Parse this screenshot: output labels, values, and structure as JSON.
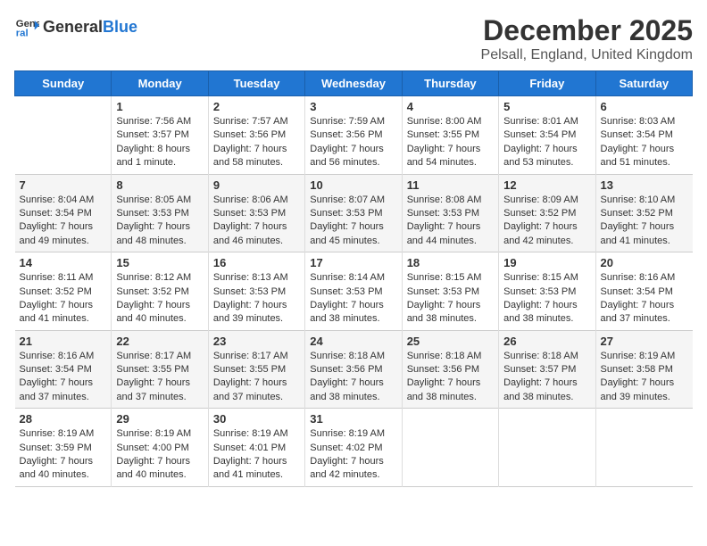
{
  "header": {
    "logo_general": "General",
    "logo_blue": "Blue",
    "title": "December 2025",
    "subtitle": "Pelsall, England, United Kingdom"
  },
  "calendar": {
    "days_of_week": [
      "Sunday",
      "Monday",
      "Tuesday",
      "Wednesday",
      "Thursday",
      "Friday",
      "Saturday"
    ],
    "weeks": [
      {
        "row_class": "white-row",
        "days": [
          {
            "num": "",
            "content": ""
          },
          {
            "num": "1",
            "content": "Sunrise: 7:56 AM\nSunset: 3:57 PM\nDaylight: 8 hours\nand 1 minute."
          },
          {
            "num": "2",
            "content": "Sunrise: 7:57 AM\nSunset: 3:56 PM\nDaylight: 7 hours\nand 58 minutes."
          },
          {
            "num": "3",
            "content": "Sunrise: 7:59 AM\nSunset: 3:56 PM\nDaylight: 7 hours\nand 56 minutes."
          },
          {
            "num": "4",
            "content": "Sunrise: 8:00 AM\nSunset: 3:55 PM\nDaylight: 7 hours\nand 54 minutes."
          },
          {
            "num": "5",
            "content": "Sunrise: 8:01 AM\nSunset: 3:54 PM\nDaylight: 7 hours\nand 53 minutes."
          },
          {
            "num": "6",
            "content": "Sunrise: 8:03 AM\nSunset: 3:54 PM\nDaylight: 7 hours\nand 51 minutes."
          }
        ]
      },
      {
        "row_class": "stripe-row",
        "days": [
          {
            "num": "7",
            "content": "Sunrise: 8:04 AM\nSunset: 3:54 PM\nDaylight: 7 hours\nand 49 minutes."
          },
          {
            "num": "8",
            "content": "Sunrise: 8:05 AM\nSunset: 3:53 PM\nDaylight: 7 hours\nand 48 minutes."
          },
          {
            "num": "9",
            "content": "Sunrise: 8:06 AM\nSunset: 3:53 PM\nDaylight: 7 hours\nand 46 minutes."
          },
          {
            "num": "10",
            "content": "Sunrise: 8:07 AM\nSunset: 3:53 PM\nDaylight: 7 hours\nand 45 minutes."
          },
          {
            "num": "11",
            "content": "Sunrise: 8:08 AM\nSunset: 3:53 PM\nDaylight: 7 hours\nand 44 minutes."
          },
          {
            "num": "12",
            "content": "Sunrise: 8:09 AM\nSunset: 3:52 PM\nDaylight: 7 hours\nand 42 minutes."
          },
          {
            "num": "13",
            "content": "Sunrise: 8:10 AM\nSunset: 3:52 PM\nDaylight: 7 hours\nand 41 minutes."
          }
        ]
      },
      {
        "row_class": "white-row",
        "days": [
          {
            "num": "14",
            "content": "Sunrise: 8:11 AM\nSunset: 3:52 PM\nDaylight: 7 hours\nand 41 minutes."
          },
          {
            "num": "15",
            "content": "Sunrise: 8:12 AM\nSunset: 3:52 PM\nDaylight: 7 hours\nand 40 minutes."
          },
          {
            "num": "16",
            "content": "Sunrise: 8:13 AM\nSunset: 3:53 PM\nDaylight: 7 hours\nand 39 minutes."
          },
          {
            "num": "17",
            "content": "Sunrise: 8:14 AM\nSunset: 3:53 PM\nDaylight: 7 hours\nand 38 minutes."
          },
          {
            "num": "18",
            "content": "Sunrise: 8:15 AM\nSunset: 3:53 PM\nDaylight: 7 hours\nand 38 minutes."
          },
          {
            "num": "19",
            "content": "Sunrise: 8:15 AM\nSunset: 3:53 PM\nDaylight: 7 hours\nand 38 minutes."
          },
          {
            "num": "20",
            "content": "Sunrise: 8:16 AM\nSunset: 3:54 PM\nDaylight: 7 hours\nand 37 minutes."
          }
        ]
      },
      {
        "row_class": "stripe-row",
        "days": [
          {
            "num": "21",
            "content": "Sunrise: 8:16 AM\nSunset: 3:54 PM\nDaylight: 7 hours\nand 37 minutes."
          },
          {
            "num": "22",
            "content": "Sunrise: 8:17 AM\nSunset: 3:55 PM\nDaylight: 7 hours\nand 37 minutes."
          },
          {
            "num": "23",
            "content": "Sunrise: 8:17 AM\nSunset: 3:55 PM\nDaylight: 7 hours\nand 37 minutes."
          },
          {
            "num": "24",
            "content": "Sunrise: 8:18 AM\nSunset: 3:56 PM\nDaylight: 7 hours\nand 38 minutes."
          },
          {
            "num": "25",
            "content": "Sunrise: 8:18 AM\nSunset: 3:56 PM\nDaylight: 7 hours\nand 38 minutes."
          },
          {
            "num": "26",
            "content": "Sunrise: 8:18 AM\nSunset: 3:57 PM\nDaylight: 7 hours\nand 38 minutes."
          },
          {
            "num": "27",
            "content": "Sunrise: 8:19 AM\nSunset: 3:58 PM\nDaylight: 7 hours\nand 39 minutes."
          }
        ]
      },
      {
        "row_class": "white-row",
        "days": [
          {
            "num": "28",
            "content": "Sunrise: 8:19 AM\nSunset: 3:59 PM\nDaylight: 7 hours\nand 40 minutes."
          },
          {
            "num": "29",
            "content": "Sunrise: 8:19 AM\nSunset: 4:00 PM\nDaylight: 7 hours\nand 40 minutes."
          },
          {
            "num": "30",
            "content": "Sunrise: 8:19 AM\nSunset: 4:01 PM\nDaylight: 7 hours\nand 41 minutes."
          },
          {
            "num": "31",
            "content": "Sunrise: 8:19 AM\nSunset: 4:02 PM\nDaylight: 7 hours\nand 42 minutes."
          },
          {
            "num": "",
            "content": ""
          },
          {
            "num": "",
            "content": ""
          },
          {
            "num": "",
            "content": ""
          }
        ]
      }
    ]
  }
}
